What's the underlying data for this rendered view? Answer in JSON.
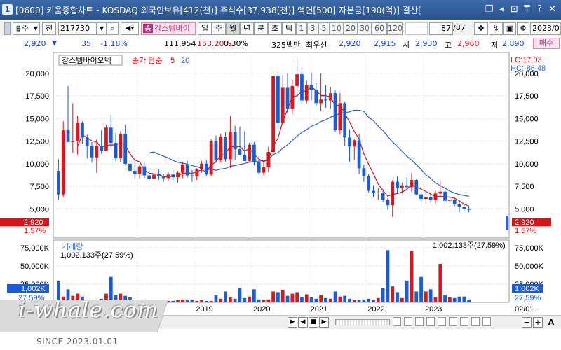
{
  "window": {
    "app_number": "1",
    "title": "[0600] 키움종합차트 - KOSDAQ 외국인보유[412(천)] 주식수[37,938(천)] 액면[500] 자본금[190(억)] 결산[",
    "buttons": [
      "❐",
      "◂",
      "⊡",
      "₸",
      "?",
      "✕"
    ]
  },
  "toolbar": {
    "stock_type": "주",
    "prev_label": "전",
    "code": "217730",
    "search_icon": "search-icon",
    "stock_name": "강스템바이",
    "period_tabs": [
      "일",
      "주",
      "월",
      "년",
      "분",
      "초",
      "틱"
    ],
    "selected_period": "월",
    "intervals": [
      "1",
      "3",
      "5",
      "10",
      "20",
      "30",
      "60",
      "120"
    ],
    "page": "87",
    "page_total": "/87",
    "date": "2023/0",
    "trade_button": "매수"
  },
  "quote": {
    "price": "2,920",
    "arrow": "▼",
    "change": "35",
    "change_pct": "-1.18%",
    "volume": "111,954",
    "vol_ratio": "153.20%",
    "turnover": "0.30%",
    "market_cap": "325백만",
    "best_label": "최우선",
    "ask": "2,920",
    "bid": "2,915",
    "open_label": "시",
    "open": "2,930",
    "high_label": "고",
    "high": "2,960",
    "low_label": "저",
    "low": "2,890"
  },
  "price_chart": {
    "stock_label": "강스템바이오텍",
    "ma_label": "종가 단순",
    "ma_short": "5",
    "ma_long": "20",
    "lc_label": "LC:17,03",
    "hc_label": "HC:-86,48",
    "current_price_tag": "2,920",
    "current_pct_tag": "1.57%"
  },
  "volume_chart": {
    "label": "거래량",
    "current_volume_label": "1,002,133주(27,59%)",
    "current_volume_tag": "1,002K",
    "current_pct_tag": "27,59%"
  },
  "bottombar": {
    "date_label": "02/01",
    "nav": [
      "▶",
      "◀",
      "■",
      "▶"
    ],
    "zoom_minus": "−",
    "zoom_plus": "+",
    "zoom_font": "A"
  },
  "watermark": {
    "text": "i-whale.com",
    "since": "SINCE 2023.01.01"
  },
  "chart_data": {
    "type": "candlestick",
    "x_tick_labels": [
      "2018",
      "2019",
      "2020",
      "2021",
      "2022",
      "2023"
    ],
    "y_tick_labels": [
      "20,000",
      "17,500",
      "15,000",
      "12,500",
      "10,000",
      "7,500",
      "5,000"
    ],
    "ylim": [
      2000,
      22000
    ],
    "volume_tick_labels": [
      "75,000K",
      "50,000K",
      "25,000K"
    ],
    "volume_ylim": [
      0,
      80000
    ],
    "ohlc": [
      [
        9200,
        10500,
        6000,
        6600
      ],
      [
        6600,
        14700,
        6300,
        13700
      ],
      [
        13700,
        18600,
        12400,
        12400
      ],
      [
        12400,
        16700,
        11200,
        12500
      ],
      [
        12500,
        15300,
        11000,
        14500
      ],
      [
        14500,
        14700,
        12200,
        12900
      ],
      [
        12900,
        13200,
        10600,
        12000
      ],
      [
        12000,
        12400,
        10100,
        10700
      ],
      [
        10700,
        12700,
        9000,
        12000
      ],
      [
        12000,
        13700,
        11100,
        11400
      ],
      [
        11400,
        14300,
        11400,
        14000
      ],
      [
        14000,
        15400,
        11800,
        12300
      ],
      [
        12300,
        13400,
        10300,
        10600
      ],
      [
        10600,
        13600,
        10200,
        13300
      ],
      [
        13300,
        14300,
        9900,
        10000
      ],
      [
        10000,
        11800,
        8500,
        9200
      ],
      [
        9200,
        10400,
        8400,
        8900
      ],
      [
        8900,
        9900,
        8300,
        9700
      ],
      [
        9700,
        10100,
        8400,
        8700
      ],
      [
        8700,
        9200,
        8100,
        8300
      ],
      [
        8300,
        9200,
        8000,
        8800
      ],
      [
        8800,
        9400,
        8200,
        8600
      ],
      [
        8600,
        8900,
        8000,
        8400
      ],
      [
        8400,
        9100,
        8100,
        8800
      ],
      [
        8800,
        9300,
        8200,
        8500
      ],
      [
        8500,
        9200,
        7900,
        9000
      ],
      [
        9000,
        10200,
        8400,
        9900
      ],
      [
        9900,
        10300,
        8500,
        8700
      ],
      [
        8700,
        9300,
        8000,
        8600
      ],
      [
        8600,
        9500,
        8200,
        9400
      ],
      [
        9400,
        10300,
        9000,
        10000
      ],
      [
        10000,
        10400,
        8600,
        8800
      ],
      [
        8800,
        12700,
        8600,
        12500
      ],
      [
        12500,
        13100,
        10100,
        10400
      ],
      [
        10400,
        13300,
        10100,
        13000
      ],
      [
        13000,
        13500,
        10200,
        10500
      ],
      [
        10500,
        15300,
        9500,
        13500
      ],
      [
        13500,
        14200,
        10400,
        11600
      ],
      [
        11600,
        14100,
        11000,
        11000
      ],
      [
        11000,
        13600,
        10300,
        10300
      ],
      [
        10300,
        12300,
        10100,
        12100
      ],
      [
        12100,
        12400,
        9800,
        10200
      ],
      [
        10200,
        10800,
        8800,
        9000
      ],
      [
        9000,
        10200,
        8700,
        9600
      ],
      [
        9600,
        11900,
        9100,
        11300
      ],
      [
        11300,
        20000,
        11200,
        19700
      ],
      [
        19700,
        20100,
        13800,
        14500
      ],
      [
        14500,
        19800,
        14300,
        18400
      ],
      [
        18400,
        20000,
        15600,
        16100
      ],
      [
        16100,
        19300,
        15500,
        18600
      ],
      [
        18600,
        21600,
        17500,
        19900
      ],
      [
        19900,
        20600,
        16600,
        17000
      ],
      [
        17000,
        19200,
        16700,
        18700
      ],
      [
        18700,
        20100,
        17000,
        18200
      ],
      [
        18200,
        18900,
        16400,
        16700
      ],
      [
        16700,
        20000,
        15800,
        17100
      ],
      [
        17100,
        18700,
        16200,
        17000
      ],
      [
        17000,
        18500,
        16100,
        17800
      ],
      [
        17800,
        18100,
        13500,
        13700
      ],
      [
        13700,
        17800,
        13200,
        16700
      ],
      [
        16700,
        16900,
        12000,
        12900
      ],
      [
        12900,
        13800,
        10200,
        11900
      ],
      [
        11900,
        12700,
        10400,
        12600
      ],
      [
        12600,
        13300,
        8900,
        9500
      ],
      [
        9500,
        9900,
        8000,
        8600
      ],
      [
        8600,
        8900,
        6800,
        7000
      ],
      [
        7000,
        7600,
        6300,
        6800
      ],
      [
        6800,
        7300,
        6000,
        6800
      ],
      [
        6800,
        7200,
        5800,
        6000
      ],
      [
        6000,
        6200,
        4900,
        5400
      ],
      [
        5400,
        8200,
        4100,
        8000
      ],
      [
        8000,
        8600,
        6700,
        7300
      ],
      [
        7300,
        7900,
        6700,
        7600
      ],
      [
        7600,
        8500,
        7000,
        7400
      ],
      [
        7400,
        9000,
        6900,
        8200
      ],
      [
        8200,
        8300,
        6500,
        6600
      ],
      [
        6600,
        6900,
        5800,
        6100
      ],
      [
        6100,
        6700,
        5600,
        6300
      ],
      [
        6300,
        6700,
        5700,
        6000
      ],
      [
        6000,
        7000,
        5600,
        6700
      ],
      [
        6700,
        8100,
        6600,
        6900
      ],
      [
        6900,
        7100,
        5700,
        5900
      ],
      [
        5900,
        6400,
        5500,
        6000
      ],
      [
        6000,
        6200,
        5300,
        5500
      ],
      [
        5500,
        5900,
        4600,
        5200
      ],
      [
        5200,
        5500,
        4700,
        5000
      ],
      [
        5000,
        5300,
        4600,
        4900
      ]
    ],
    "volume": [
      30000,
      8000,
      18000,
      9000,
      12000,
      8000,
      3000,
      3000,
      4000,
      5000,
      12000,
      35000,
      10000,
      12000,
      9000,
      7000,
      3000,
      2000,
      4000,
      2000,
      3000,
      2000,
      3000,
      2000,
      2000,
      3000,
      4000,
      4000,
      3000,
      2000,
      3000,
      2000,
      2000,
      10000,
      5000,
      15000,
      7000,
      5000,
      20000,
      6000,
      8000,
      18000,
      4000,
      3000,
      4000,
      15000,
      14000,
      17000,
      9000,
      12000,
      14000,
      7000,
      11000,
      7000,
      5000,
      10000,
      6000,
      5000,
      15000,
      8000,
      9000,
      5000,
      3000,
      3000,
      4000,
      5000,
      3000,
      6000,
      20000,
      72000,
      22000,
      14000,
      6000,
      30000,
      71000,
      15000,
      35000,
      15000,
      18000,
      7000,
      53000,
      10000,
      7000,
      6000,
      8000,
      8000,
      4000
    ]
  }
}
